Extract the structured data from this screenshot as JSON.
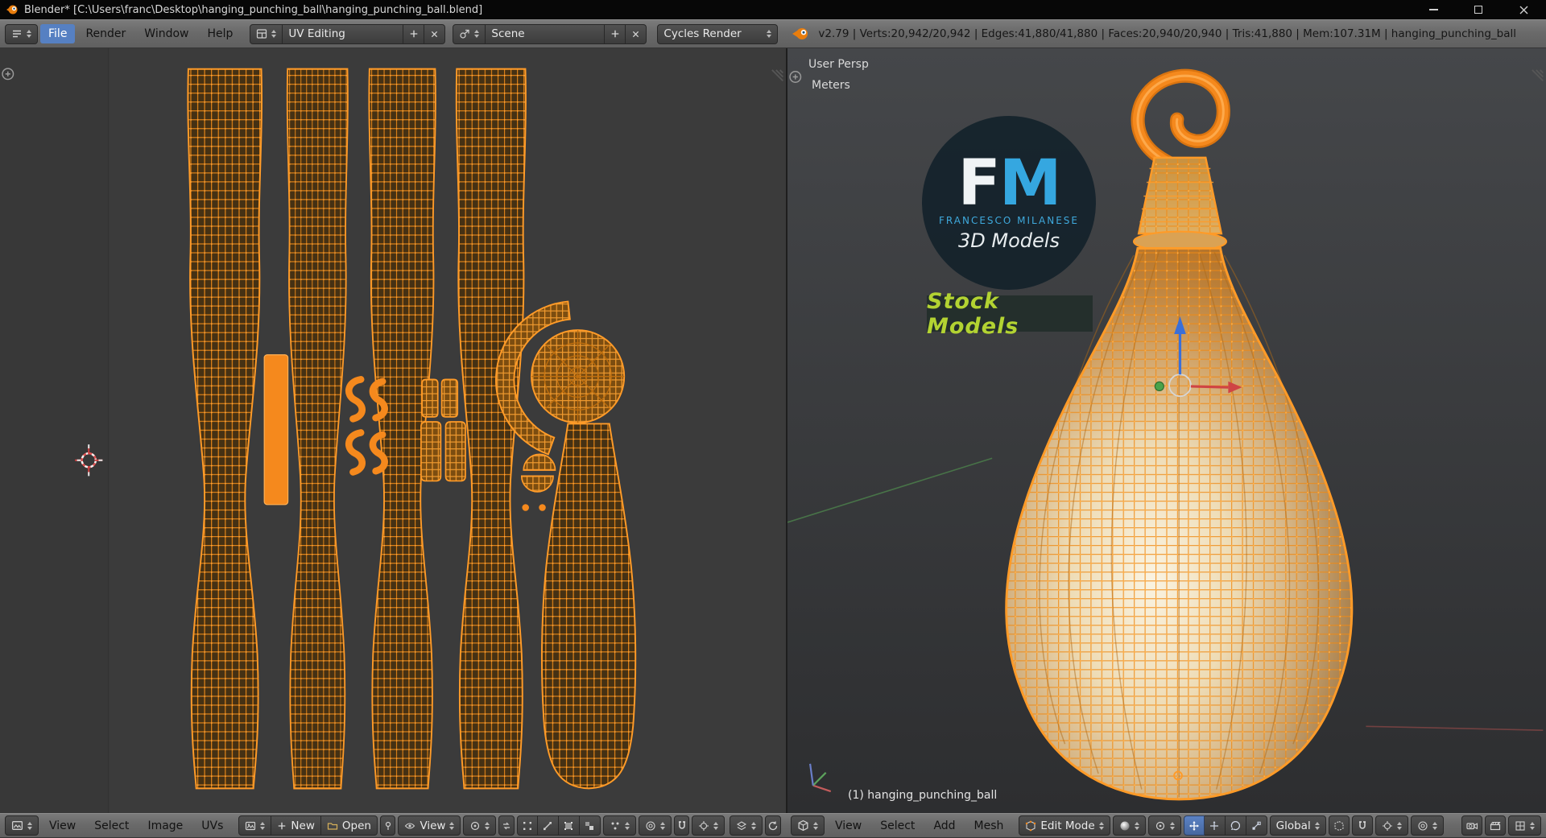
{
  "colors": {
    "accent_orange": "#f5891d",
    "wire_orange": "#ff9b28",
    "selection_blue": "#5680c2",
    "logo_blue": "#3fa9dc",
    "stock_green": "#b3d332",
    "header_gray": "#6a6a6a"
  },
  "titlebar": {
    "app_title": "Blender* [C:\\Users\\franc\\Desktop\\hanging_punching_ball\\hanging_punching_ball.blend]"
  },
  "info_header": {
    "menu_file": "File",
    "menu_render": "Render",
    "menu_window": "Window",
    "menu_help": "Help",
    "layout_name": "UV Editing",
    "scene_name": "Scene",
    "engine_name": "Cycles Render",
    "stats": "v2.79 | Verts:20,942/20,942 | Edges:41,880/41,880 | Faces:20,940/20,940 | Tris:41,880 | Mem:107.31M | hanging_punching_ball"
  },
  "uv_editor": {
    "header": {
      "menu_view": "View",
      "menu_select": "Select",
      "menu_image": "Image",
      "menu_uvs": "UVs",
      "new_button": "New",
      "open_button": "Open",
      "mode_value": "View"
    }
  },
  "viewport3d": {
    "view_label": "User Persp",
    "units_label": "Meters",
    "object_info": "(1) hanging_punching_ball",
    "watermark": {
      "initial_f": "F",
      "initial_m": "M",
      "brand": "FRANCESCO MILANESE",
      "brand_sub": "3D Models",
      "banner": "Stock Models"
    },
    "header": {
      "menu_view": "View",
      "menu_select": "Select",
      "menu_add": "Add",
      "menu_mesh": "Mesh",
      "mode_value": "Edit Mode",
      "orientation_value": "Global"
    }
  }
}
